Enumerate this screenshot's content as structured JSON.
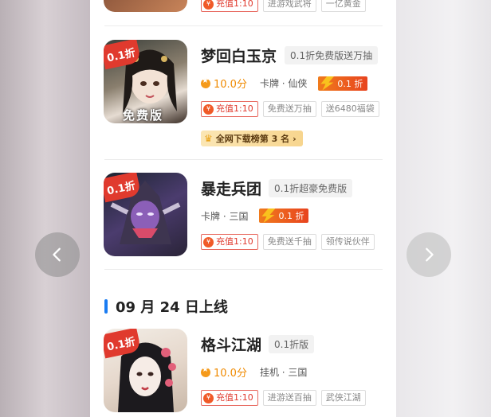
{
  "nav": {
    "prev_icon": "chevron-left-icon",
    "next_icon": "chevron-right-icon"
  },
  "top_partial": {
    "recharge": "充值1:10",
    "tags": [
      "进游戏武将",
      "一亿黄金"
    ]
  },
  "games": [
    {
      "discount": "0.1折",
      "thumb_label": "免费版",
      "title": "梦回白玉京",
      "subtitle": "0.1折免费版送万抽",
      "score": "10.0分",
      "genre": "卡牌 · 仙侠",
      "discount_badge": "0.1 折",
      "recharge": "充值1:10",
      "tags": [
        "免费送万抽",
        "送6480福袋"
      ],
      "rank": "全网下载榜第 3 名"
    },
    {
      "discount": "0.1折",
      "title": "暴走兵团",
      "subtitle": "0.1折超豪免费版",
      "genre": "卡牌 · 三国",
      "discount_badge": "0.1 折",
      "recharge": "充值1:10",
      "tags": [
        "免费送千抽",
        "领传说伙伴"
      ]
    }
  ],
  "section": {
    "title": "09 月 24 日上线"
  },
  "new_games": [
    {
      "discount": "0.1折",
      "title": "格斗江湖",
      "subtitle": "0.1折版",
      "score": "10.0分",
      "genre": "挂机 · 三国",
      "recharge": "充值1:10",
      "tags": [
        "进游送百抽",
        "武侠江湖"
      ]
    }
  ],
  "colors": {
    "accent_blue": "#1a7cf2",
    "discount_red": "#e03a2e",
    "score_orange": "#f08a00"
  }
}
